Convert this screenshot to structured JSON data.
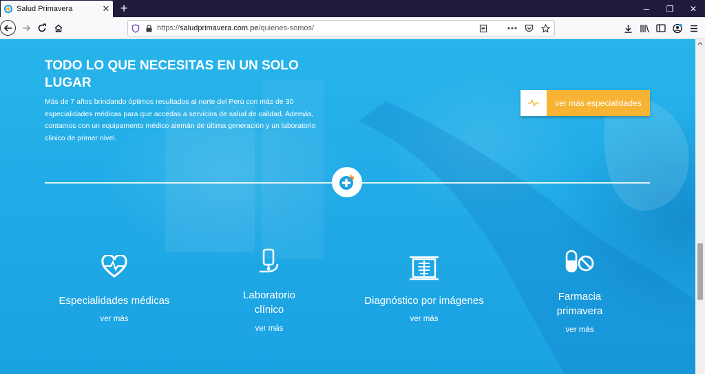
{
  "browser": {
    "tab_title": "Salud Primavera",
    "url_prefix": "https://",
    "url_host": "saludprimavera.com.pe",
    "url_path": "/quienes-somos/"
  },
  "hero": {
    "title_line1": "TODO LO QUE NECESITAS EN UN SOLO",
    "title_line2": "LUGAR",
    "description": "Más de 7 años brindando óptimos resultados al norte del Perú con más de 30 especialidades médicas para que accedas a servicios de salud de calidad. Además, contamos con un equipamento médico alemán de última generación y un laboratorio clínico de primer nivel.",
    "cta_label": "ver más especialidades"
  },
  "services": [
    {
      "title": "Especialidades médicas",
      "link": "ver más",
      "icon": "heart-pulse-icon"
    },
    {
      "title_line1": "Laboratorio",
      "title_line2": "clínico",
      "link": "ver más",
      "icon": "microscope-icon"
    },
    {
      "title": "Diagnóstico por imágenes",
      "link": "ver más",
      "icon": "xray-icon"
    },
    {
      "title_line1": "Farmacia",
      "title_line2": "primavera",
      "link": "ver más",
      "icon": "pills-icon"
    }
  ],
  "colors": {
    "background": "#22aee8",
    "accent": "#f7b333",
    "chrome": "#1e1b3c"
  }
}
